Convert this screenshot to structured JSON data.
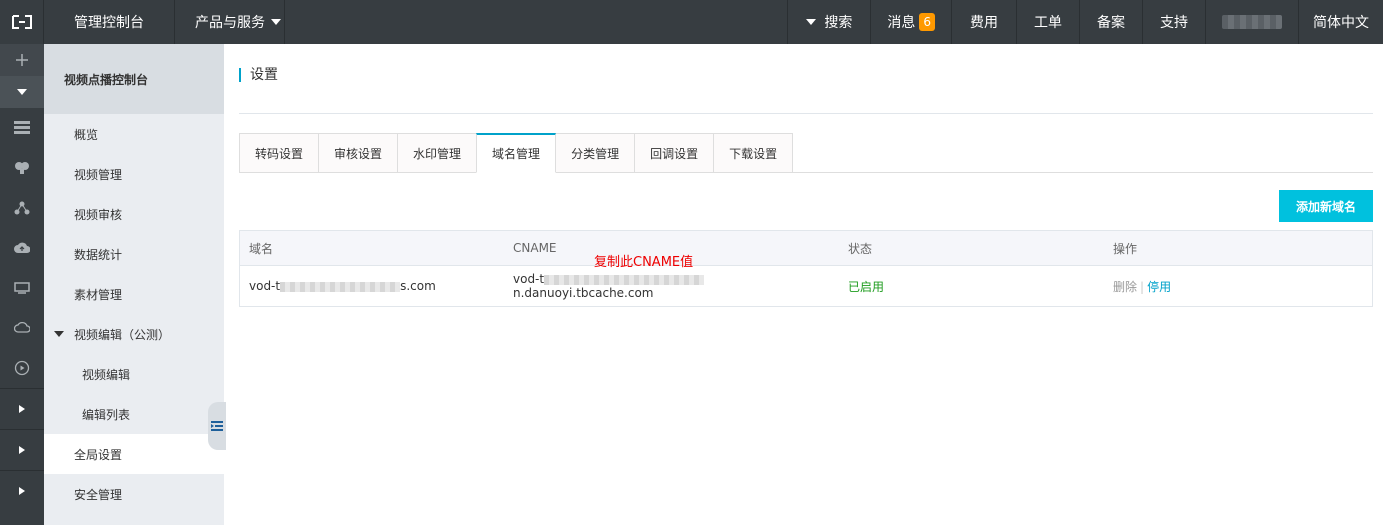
{
  "topbar": {
    "console": "管理控制台",
    "products": "产品与服务",
    "search": "搜索",
    "messages": "消息",
    "message_count": "6",
    "billing": "费用",
    "tickets": "工单",
    "icp": "备案",
    "support": "支持",
    "language": "简体中文"
  },
  "sidebar": {
    "title": "视频点播控制台",
    "items": [
      {
        "label": "概览"
      },
      {
        "label": "视频管理"
      },
      {
        "label": "视频审核"
      },
      {
        "label": "数据统计"
      },
      {
        "label": "素材管理"
      },
      {
        "label": "视频编辑（公测）"
      },
      {
        "label": "视频编辑"
      },
      {
        "label": "编辑列表"
      },
      {
        "label": "全局设置"
      },
      {
        "label": "安全管理"
      }
    ]
  },
  "main": {
    "title": "设置",
    "tabs": [
      {
        "label": "转码设置"
      },
      {
        "label": "审核设置"
      },
      {
        "label": "水印管理"
      },
      {
        "label": "域名管理"
      },
      {
        "label": "分类管理"
      },
      {
        "label": "回调设置"
      },
      {
        "label": "下载设置"
      }
    ],
    "add_button": "添加新域名",
    "table": {
      "headers": [
        "域名",
        "CNAME",
        "状态",
        "操作"
      ],
      "rows": [
        {
          "domain_prefix": "vod-t",
          "domain_suffix": "s.com",
          "cname_prefix": "vod-t",
          "cname_suffix": "n.danuoyi.tbcache.com",
          "status": "已启用",
          "op_delete": "删除",
          "op_sep": "|",
          "op_disable": "停用"
        }
      ]
    },
    "annotation": "复制此CNAME值"
  },
  "colors": {
    "topbar_bg": "#373d41",
    "accent": "#00c1de",
    "tab_active": "#00a2ca",
    "status_enabled": "#1e9c1e",
    "annotation": "#e00000",
    "badge": "#ff9900"
  },
  "icons": [
    "aliyun-logo-icon",
    "plus-icon",
    "caret-down-icon",
    "server-icon",
    "brain-icon",
    "nodes-icon",
    "cloud-upload-icon",
    "monitor-icon",
    "cloud-icon",
    "play-circle-icon",
    "chevron-right-icon",
    "collapse-icon"
  ]
}
